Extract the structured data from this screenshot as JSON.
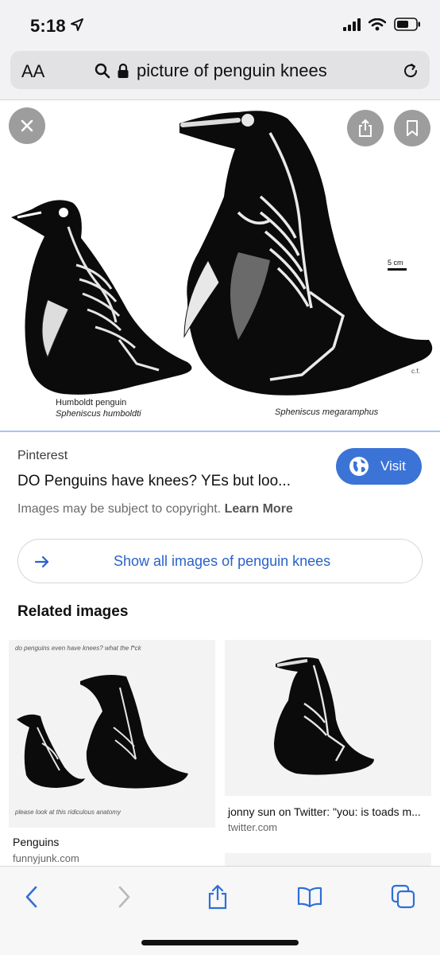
{
  "status_bar": {
    "time": "5:18"
  },
  "url_bar": {
    "aa_label": "AA",
    "url_text": "picture of penguin knees"
  },
  "viewer": {
    "caption_left_1": "Humboldt penguin",
    "caption_left_2": "Spheniscus humboldti",
    "caption_right": "Spheniscus megaramphus",
    "scale_label": "5 cm",
    "artist_mark": "c.f."
  },
  "result": {
    "source": "Pinterest",
    "title": "DO Penguins have knees? YEs but loo...",
    "visit_label": "Visit",
    "copyright_text": "Images may be subject to copyright.",
    "learn_more": "Learn More"
  },
  "show_all": {
    "label": "Show all images of penguin knees"
  },
  "related": {
    "heading": "Related images",
    "cards": [
      {
        "top_caption": "do penguins even have knees? what the f*ck",
        "bottom_caption": "please look at this ridiculous anatomy",
        "title": "Penguins",
        "domain": "funnyjunk.com"
      },
      {
        "title": "jonny sun on Twitter: \"you: is toads m...",
        "domain": "twitter.com"
      }
    ]
  },
  "colors": {
    "accent": "#3b74d6",
    "link": "#2a62c9",
    "chrome_bg": "#f2f2f4"
  }
}
